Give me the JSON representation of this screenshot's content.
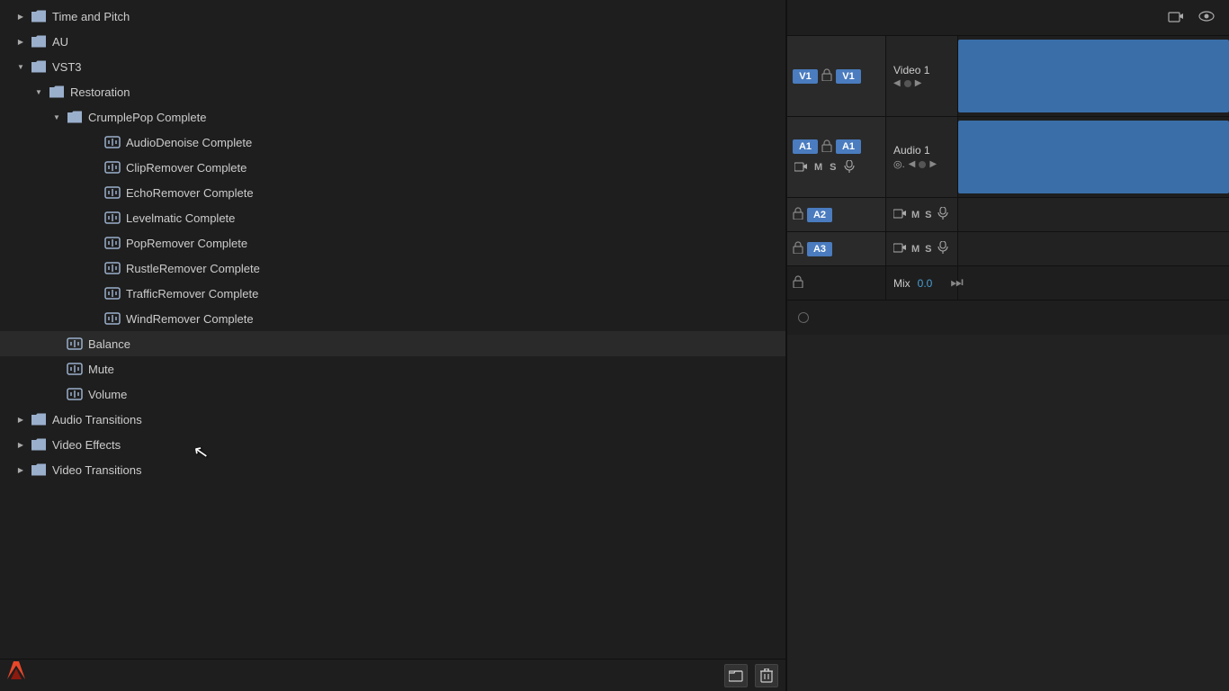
{
  "leftPanel": {
    "treeItems": [
      {
        "id": "time-pitch",
        "level": 1,
        "type": "folder",
        "label": "Time and Pitch",
        "chevron": "right",
        "collapsed": true
      },
      {
        "id": "au",
        "level": 1,
        "type": "folder",
        "label": "AU",
        "chevron": "right",
        "collapsed": true
      },
      {
        "id": "vst3",
        "level": 1,
        "type": "folder",
        "label": "VST3",
        "chevron": "down",
        "collapsed": false
      },
      {
        "id": "restoration",
        "level": 2,
        "type": "folder",
        "label": "Restoration",
        "chevron": "down",
        "collapsed": false
      },
      {
        "id": "crumplepop",
        "level": 3,
        "type": "folder",
        "label": "CrumplePop Complete",
        "chevron": "down",
        "collapsed": false
      },
      {
        "id": "audiodenoise",
        "level": 4,
        "type": "plugin",
        "label": "AudioDenoise Complete"
      },
      {
        "id": "clipremover",
        "level": 4,
        "type": "plugin",
        "label": "ClipRemover Complete"
      },
      {
        "id": "echoremover",
        "level": 4,
        "type": "plugin",
        "label": "EchoRemover Complete"
      },
      {
        "id": "levelmatic",
        "level": 4,
        "type": "plugin",
        "label": "Levelmatic Complete"
      },
      {
        "id": "popremover",
        "level": 4,
        "type": "plugin",
        "label": "PopRemover Complete"
      },
      {
        "id": "rustleremover",
        "level": 4,
        "type": "plugin",
        "label": "RustleRemover Complete"
      },
      {
        "id": "trafficremover",
        "level": 4,
        "type": "plugin",
        "label": "TrafficRemover Complete"
      },
      {
        "id": "windremover",
        "level": 4,
        "type": "plugin",
        "label": "WindRemover Complete"
      },
      {
        "id": "balance",
        "level": 3,
        "type": "plugin",
        "label": "Balance"
      },
      {
        "id": "mute",
        "level": 3,
        "type": "plugin",
        "label": "Mute"
      },
      {
        "id": "volume",
        "level": 3,
        "type": "plugin",
        "label": "Volume"
      },
      {
        "id": "audio-transitions",
        "level": 1,
        "type": "folder",
        "label": "Audio Transitions",
        "chevron": "right",
        "collapsed": true
      },
      {
        "id": "video-effects",
        "level": 1,
        "type": "folder",
        "label": "Video Effects",
        "chevron": "right",
        "collapsed": true
      },
      {
        "id": "video-transitions",
        "level": 1,
        "type": "folder",
        "label": "Video Transitions",
        "chevron": "right",
        "collapsed": true
      }
    ],
    "toolbar": {
      "newFolderLabel": "📁",
      "deleteLabel": "🗑"
    }
  },
  "rightPanel": {
    "headerIcons": [
      "camera-icon",
      "eye-icon"
    ],
    "tracks": {
      "v1": {
        "label": "V1",
        "name": "Video 1",
        "hasClip": true
      },
      "a1": {
        "label": "A1",
        "name": "Audio 1",
        "hasClip": true
      },
      "a2": {
        "label": "A2"
      },
      "a3": {
        "label": "A3"
      }
    },
    "mix": {
      "label": "Mix",
      "value": "0.0"
    }
  }
}
